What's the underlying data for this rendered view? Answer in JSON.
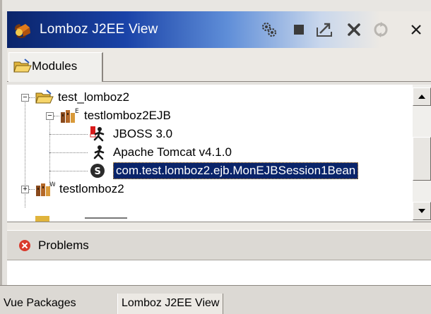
{
  "view": {
    "title": "Lomboz J2EE View",
    "toolbar": [
      {
        "icon": "gears-icon"
      },
      {
        "icon": "stop-icon"
      },
      {
        "icon": "deploy-icon"
      },
      {
        "icon": "tools-icon"
      },
      {
        "icon": "refresh-icon"
      },
      {
        "icon": "close-icon"
      }
    ]
  },
  "modules_tab": {
    "label": "Modules"
  },
  "tree": {
    "root": {
      "label": "test_lomboz2"
    },
    "ejb_module": {
      "label": "testlomboz2EJB"
    },
    "server_jboss": {
      "label": "JBOSS 3.0"
    },
    "server_tomcat": {
      "label": "Apache Tomcat v4.1.0"
    },
    "session_bean": {
      "label": "com.test.lomboz2.ejb.MonEJBSession1Bean"
    },
    "web_module": {
      "label": "testlomboz2"
    }
  },
  "problems": {
    "label": "Problems"
  },
  "bottom_tabs": [
    {
      "label": "Vue Packages"
    },
    {
      "label": "Lomboz J2EE View"
    }
  ],
  "colors": {
    "title_gradient_start": "#0a246a",
    "selection": "#0a246a",
    "error": "#d93a2c"
  }
}
